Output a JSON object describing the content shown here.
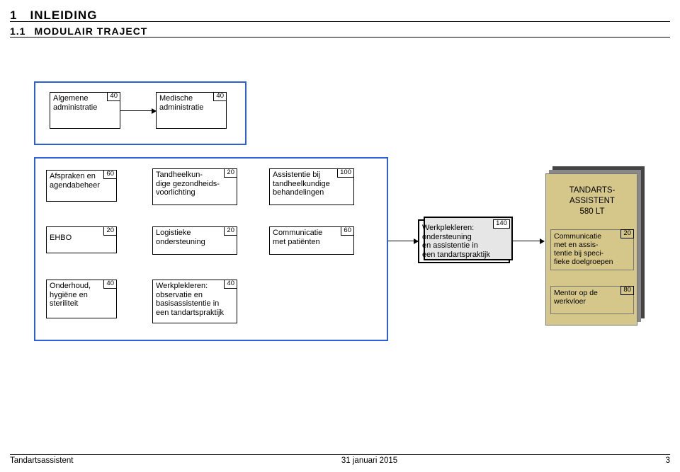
{
  "headings": {
    "top": "INLEIDING",
    "sub": "MODULAIR TRAJECT"
  },
  "modules": {
    "alg_admin": {
      "label": "Algemene\nadministratie",
      "hours": 40
    },
    "med_admin": {
      "label": "Medische\nadministratie",
      "hours": 40
    },
    "afspraken": {
      "label": "Afspraken en\nagendabeheer",
      "hours": 60
    },
    "ehbo": {
      "label": "EHBO",
      "hours": 20
    },
    "onderhoud": {
      "label": "Onderhoud,\nhygiëne en\nsteriliteit",
      "hours": 40
    },
    "tandheel": {
      "label": "Tandheelkun-\ndige gezondheids-\nvoorlichting",
      "hours": 20
    },
    "logistiek": {
      "label": "Logistieke\nondersteuning",
      "hours": 20
    },
    "wpl_obs": {
      "label": "Werkplekleren:\nobservatie en\nbasisassistentie in\neen tandartspraktijk",
      "hours": 40
    },
    "assistentie": {
      "label": "Assistentie bij\ntandheelkundige\nbehandelingen",
      "hours": 100
    },
    "communic": {
      "label": "Communicatie\nmet patiënten",
      "hours": 60
    },
    "wpl_ond": {
      "label": "Werkplekleren:\nondersteuning\nen assistentie in\neen tandartspraktijk",
      "hours": 140
    }
  },
  "target": {
    "title": "TANDARTS-\nASSISTENT\n580 LT",
    "boxes": {
      "comm_doel": {
        "label": "Communicatie\nmet en assis-\ntentie bij speci-\nfieke doelgroepen",
        "hours": 20
      },
      "mentor": {
        "label": "Mentor op de\nwerkvloer",
        "hours": 80
      }
    }
  },
  "footer": {
    "left": "Tandartsassistent",
    "center": "31 januari 2015",
    "right": "3"
  }
}
